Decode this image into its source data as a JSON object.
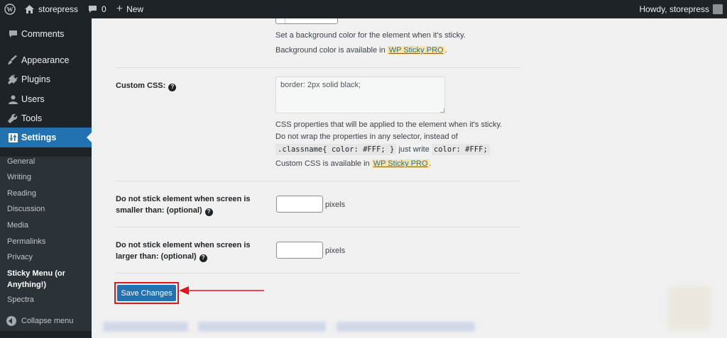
{
  "adminbar": {
    "site_name": "storepress",
    "comments_count": "0",
    "new_label": "New",
    "howdy": "Howdy, storepress"
  },
  "sidebar": {
    "items": [
      {
        "label": "Comments",
        "icon": "comment-icon"
      },
      {
        "label": "Appearance",
        "icon": "brush-icon"
      },
      {
        "label": "Plugins",
        "icon": "plug-icon"
      },
      {
        "label": "Users",
        "icon": "user-icon"
      },
      {
        "label": "Tools",
        "icon": "wrench-icon"
      },
      {
        "label": "Settings",
        "icon": "settings-icon"
      }
    ],
    "submenu": [
      "General",
      "Writing",
      "Reading",
      "Discussion",
      "Media",
      "Permalinks",
      "Privacy",
      "Sticky Menu (or Anything!)",
      "Spectra"
    ],
    "collapse_label": "Collapse menu"
  },
  "settings": {
    "bg_desc": "Set a background color for the element when it's sticky.",
    "bg_pro_prefix": "Background color is available in",
    "pro_link": "WP Sticky PRO",
    "custom_css_label": "Custom CSS:",
    "custom_css_value": "border: 2px solid black;",
    "css_desc1": "CSS properties that will be applied to the element when it's sticky.",
    "css_desc2": "Do not wrap the properties in any selector, instead of",
    "css_code1": ".classname{ color: #FFF; }",
    "css_just_write": "just write",
    "css_code2": "color: #FFF;",
    "css_pro_prefix": "Custom CSS is available in",
    "min_label_line1": "Do not stick element when screen is",
    "min_label_line2": "smaller than: (optional)",
    "max_label_line1": "Do not stick element when screen is",
    "max_label_line2": "larger than: (optional)",
    "unit": "pixels",
    "save_label": "Save Changes"
  },
  "colors": {
    "accent": "#2271b1",
    "sidebar_bg": "#1d2327",
    "highlight": "#fbe5a0",
    "callout": "#e0161e"
  }
}
